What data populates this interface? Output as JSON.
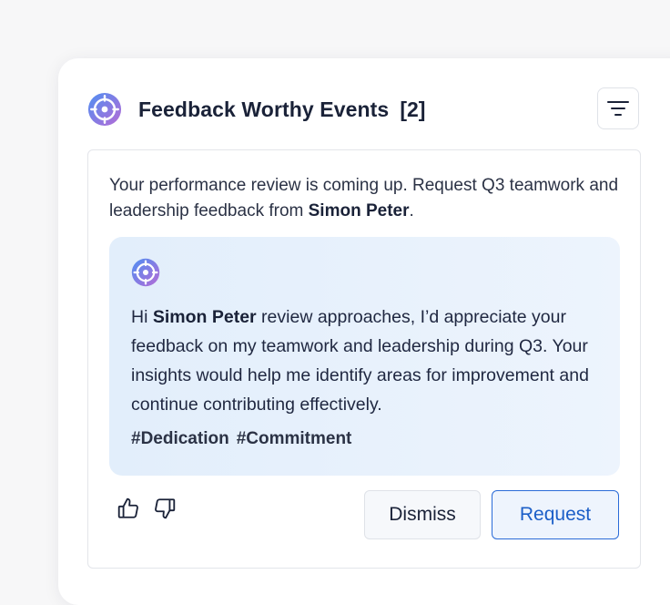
{
  "header": {
    "title": "Feedback Worthy Events",
    "count": "[2]",
    "logo_icon": "target-logo-icon",
    "filter_icon": "filter-icon"
  },
  "event": {
    "intro_prefix": "Your performance review is coming up. Request Q3 teamwork and leadership feedback from ",
    "intro_name": "Simon Peter",
    "intro_suffix": ".",
    "message": {
      "greeting": "Hi ",
      "name": "Simon Peter",
      "body": " review approaches, I’d appreciate your feedback on my teamwork and leadership during Q3. Your insights would help me identify areas for improvement and continue contributing effectively.",
      "tags": [
        "#Dedication",
        "#Commitment"
      ]
    },
    "actions": {
      "thumbs_up_icon": "thumbs-up-icon",
      "thumbs_down_icon": "thumbs-down-icon",
      "dismiss_label": "Dismiss",
      "request_label": "Request"
    }
  },
  "colors": {
    "brand_gradient_start": "#5a8df0",
    "brand_gradient_end": "#b06ad8",
    "primary": "#2a6bd8",
    "message_bg": "#e8f1fc"
  }
}
